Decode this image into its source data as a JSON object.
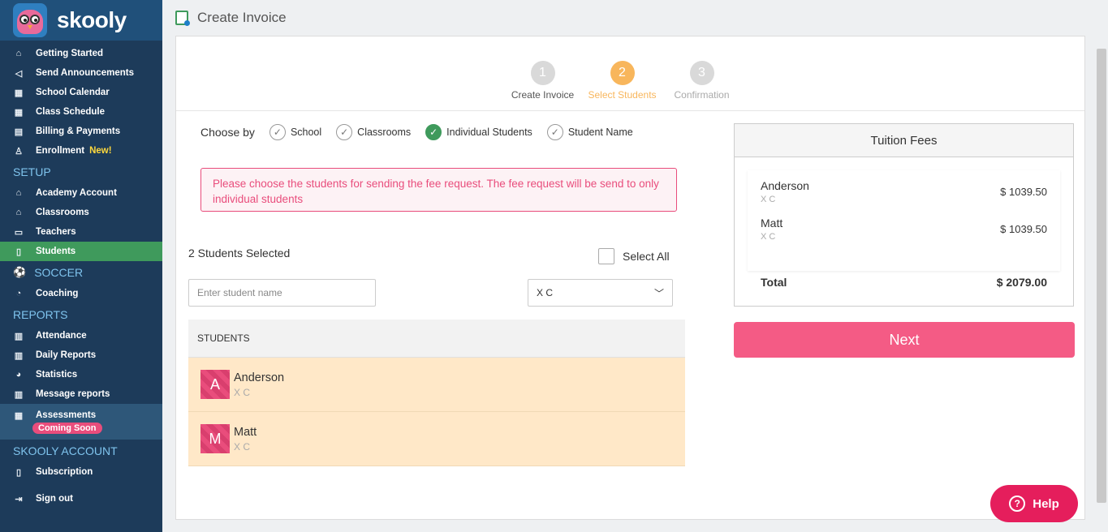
{
  "brand": {
    "name": "skooly"
  },
  "sidebar": {
    "top_items": [
      {
        "label": "Getting Started",
        "icon": "home-icon"
      },
      {
        "label": "Send Announcements",
        "icon": "megaphone-icon"
      },
      {
        "label": "School Calendar",
        "icon": "calendar-icon"
      },
      {
        "label": "Class Schedule",
        "icon": "calendar-icon"
      },
      {
        "label": "Billing & Payments",
        "icon": "billing-icon"
      },
      {
        "label": "Enrollment",
        "icon": "user-add-icon",
        "badge": "New!"
      }
    ],
    "setup": {
      "title": "SETUP",
      "items": [
        {
          "label": "Academy Account",
          "icon": "building-icon"
        },
        {
          "label": "Classrooms",
          "icon": "classroom-icon"
        },
        {
          "label": "Teachers",
          "icon": "teacher-icon"
        },
        {
          "label": "Students",
          "icon": "student-icon",
          "active": true
        }
      ]
    },
    "soccer": {
      "title": "SOCCER",
      "items": [
        {
          "label": "Coaching",
          "icon": "whistle-icon"
        }
      ]
    },
    "reports": {
      "title": "REPORTS",
      "items": [
        {
          "label": "Attendance",
          "icon": "report-icon"
        },
        {
          "label": "Daily Reports",
          "icon": "report-icon"
        },
        {
          "label": "Statistics",
          "icon": "pie-chart-icon"
        },
        {
          "label": "Message reports",
          "icon": "report-icon"
        },
        {
          "label": "Assessments",
          "icon": "calendar-icon",
          "badge": "Coming Soon"
        }
      ]
    },
    "account": {
      "title": "SKOOLY ACCOUNT",
      "items": [
        {
          "label": "Subscription",
          "icon": "bookmark-icon"
        },
        {
          "label": "Sign out",
          "icon": "sign-out-icon"
        }
      ]
    }
  },
  "page": {
    "title": "Create Invoice"
  },
  "stepper": {
    "steps": [
      {
        "num": "1",
        "label": "Create Invoice",
        "state": "done"
      },
      {
        "num": "2",
        "label": "Select Students",
        "state": "active"
      },
      {
        "num": "3",
        "label": "Confirmation",
        "state": "future"
      }
    ]
  },
  "choose_by": {
    "label": "Choose by",
    "options": [
      {
        "label": "School",
        "checked": false
      },
      {
        "label": "Classrooms",
        "checked": false
      },
      {
        "label": "Individual Students",
        "checked": true
      },
      {
        "label": "Student Name",
        "checked": false
      }
    ]
  },
  "alert": {
    "text": "Please choose the students for sending the fee request. The fee request will be send to only individual students"
  },
  "selection": {
    "count_text": "2 Students Selected",
    "select_all_label": "Select All"
  },
  "search": {
    "placeholder": "Enter student name"
  },
  "class_filter": {
    "value": "X C"
  },
  "students_table": {
    "header": "STUDENTS",
    "rows": [
      {
        "initial": "A",
        "name": "Anderson",
        "class": "X C"
      },
      {
        "initial": "M",
        "name": "Matt",
        "class": "X C"
      }
    ]
  },
  "fees": {
    "title": "Tuition Fees",
    "items": [
      {
        "name": "Anderson",
        "class": "X C",
        "amount": "$ 1039.50"
      },
      {
        "name": "Matt",
        "class": "X C",
        "amount": "$ 1039.50"
      }
    ],
    "total_label": "Total",
    "total_amount": "$ 2079.00"
  },
  "next_button": {
    "label": "Next"
  },
  "help_button": {
    "label": "Help"
  },
  "colors": {
    "sidebar": "#1d3b5a",
    "active_green": "#3f9a5c",
    "accent_pink": "#f45b85",
    "step_active": "#f8b65c"
  }
}
